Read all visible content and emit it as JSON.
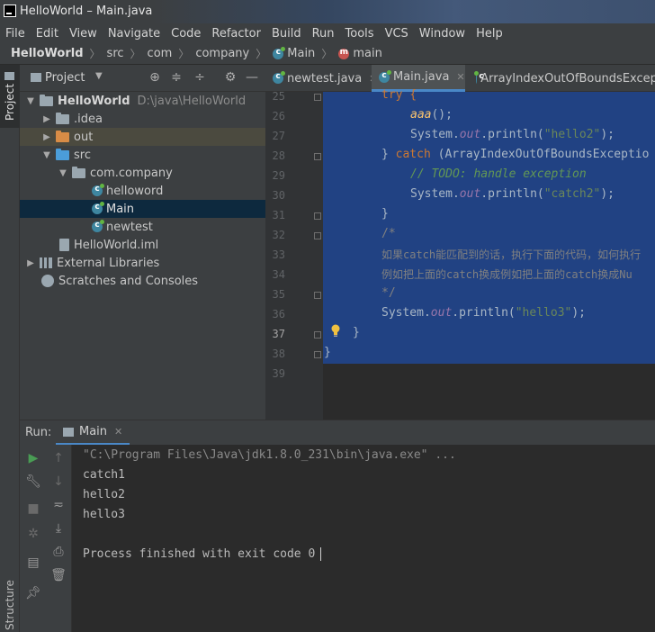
{
  "window": {
    "title": "HelloWorld – Main.java"
  },
  "menu": [
    "File",
    "Edit",
    "View",
    "Navigate",
    "Code",
    "Refactor",
    "Build",
    "Run",
    "Tools",
    "VCS",
    "Window",
    "Help"
  ],
  "breadcrumb": [
    "HelloWorld",
    "src",
    "com",
    "company",
    "Main",
    "main"
  ],
  "sidebar": {
    "project_tab": "Project",
    "structure_tab": "Structure"
  },
  "project": {
    "title": "Project",
    "tree": [
      {
        "label": "HelloWorld",
        "path": "D:\\java\\HelloWorld"
      },
      {
        "label": ".idea"
      },
      {
        "label": "out"
      },
      {
        "label": "src"
      },
      {
        "label": "com.company"
      },
      {
        "label": "helloword"
      },
      {
        "label": "Main"
      },
      {
        "label": "newtest"
      },
      {
        "label": "HelloWorld.iml"
      },
      {
        "label": "External Libraries"
      },
      {
        "label": "Scratches and Consoles"
      }
    ]
  },
  "editor": {
    "tabs": [
      "newtest.java",
      "Main.java",
      "ArrayIndexOutOfBoundsExcept"
    ],
    "line_numbers": [
      "25",
      "26",
      "27",
      "28",
      "29",
      "30",
      "31",
      "32",
      "33",
      "34",
      "35",
      "36",
      "37",
      "38",
      "39"
    ],
    "code": {
      "l25": "try {",
      "l26_fn": "aaa",
      "l26_rest": "();",
      "l27_a": "System.",
      "l27_out": "out",
      "l27_b": ".println(",
      "l27_str": "\"hello2\"",
      "l27_c": ");",
      "l28_a": "} ",
      "l28_kw": "catch",
      "l28_b": " (ArrayIndexOutOfBoundsExceptio",
      "l29": "// TODO: handle exception",
      "l30_a": "System.",
      "l30_out": "out",
      "l30_b": ".println(",
      "l30_str": "\"catch2\"",
      "l30_c": ");",
      "l31": "}",
      "l32": "/*",
      "l33": "如果catch能匹配到的话，执行下面的代码，如何执行",
      "l34": "例如把上面的catch换成例如把上面的catch换成Nu",
      "l35": "*/",
      "l36_a": "System.",
      "l36_out": "out",
      "l36_b": ".println(",
      "l36_str": "\"hello3\"",
      "l36_c": ");",
      "l37": "}",
      "l38": "}"
    }
  },
  "run": {
    "label": "Run:",
    "tab": "Main",
    "output": [
      "\"C:\\Program Files\\Java\\jdk1.8.0_231\\bin\\java.exe\" ...",
      "catch1",
      "hello2",
      "hello3",
      "",
      "Process finished with exit code 0"
    ]
  },
  "colors": {
    "selection": "#214283",
    "accent": "#4a88c7",
    "keyword": "#cc7832",
    "string": "#6a8759"
  }
}
